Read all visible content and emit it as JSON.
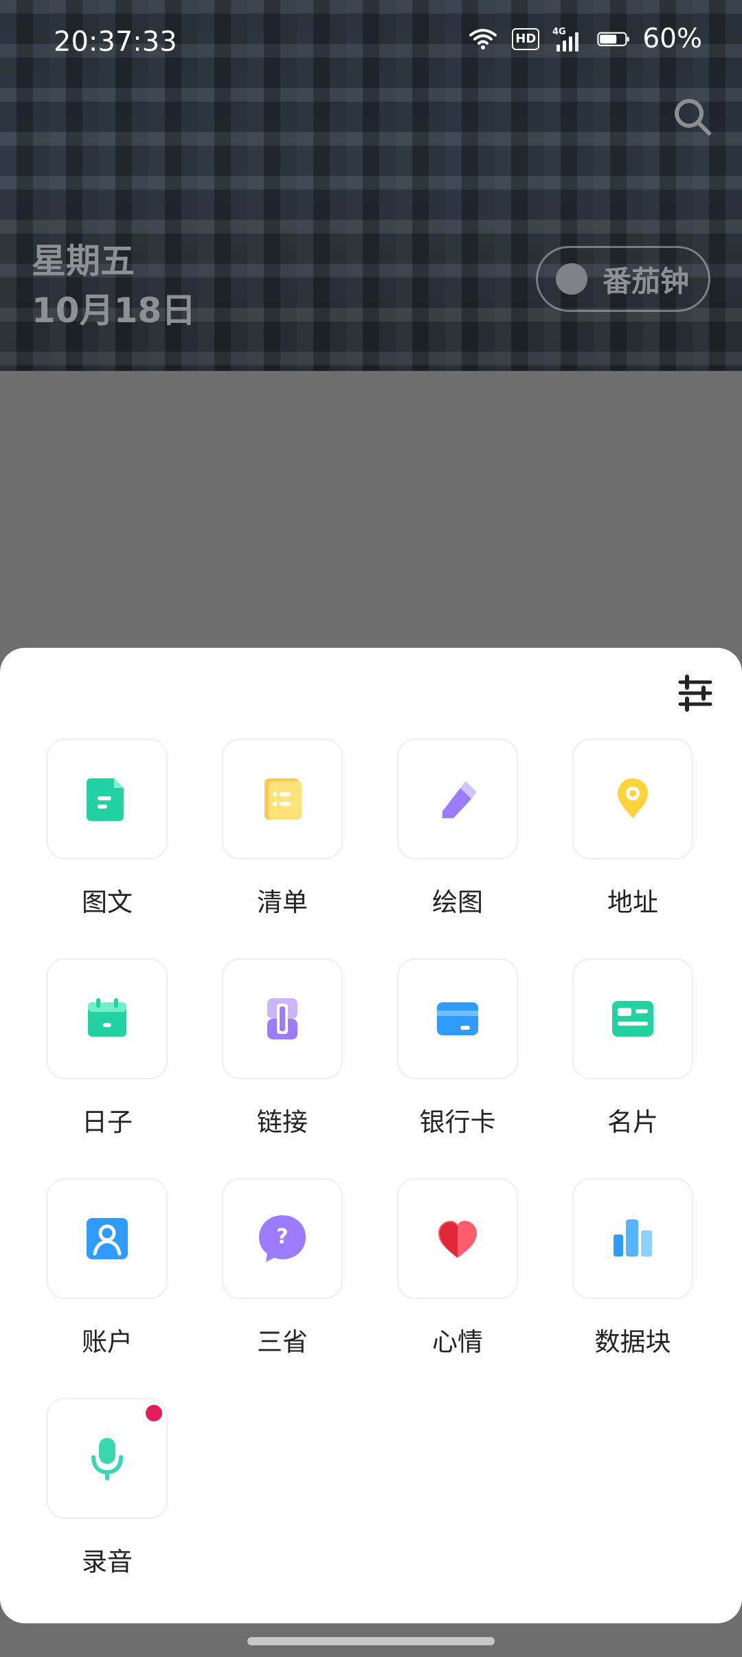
{
  "status_bar": {
    "time": "20:37:33",
    "battery_percent": "60%",
    "network": "4G",
    "hd": "HD"
  },
  "header": {
    "weekday": "星期五",
    "date": "10月18日",
    "pomodoro_label": "番茄钟"
  },
  "sheet": {
    "items": [
      {
        "label": "图文",
        "icon": "document-icon"
      },
      {
        "label": "清单",
        "icon": "checklist-icon"
      },
      {
        "label": "绘图",
        "icon": "pencil-icon"
      },
      {
        "label": "地址",
        "icon": "location-pin-icon"
      },
      {
        "label": "日子",
        "icon": "calendar-icon"
      },
      {
        "label": "链接",
        "icon": "link-icon"
      },
      {
        "label": "银行卡",
        "icon": "bank-card-icon"
      },
      {
        "label": "名片",
        "icon": "business-card-icon"
      },
      {
        "label": "账户",
        "icon": "account-icon"
      },
      {
        "label": "三省",
        "icon": "question-bubble-icon"
      },
      {
        "label": "心情",
        "icon": "heart-icon"
      },
      {
        "label": "数据块",
        "icon": "bar-chart-icon"
      },
      {
        "label": "录音",
        "icon": "microphone-icon"
      }
    ]
  },
  "colors": {
    "accent_red": "#e31d5b",
    "teal": "#22d2a0",
    "yellow": "#ffd43b",
    "purple": "#9b7cff",
    "blue": "#2f9bff"
  }
}
